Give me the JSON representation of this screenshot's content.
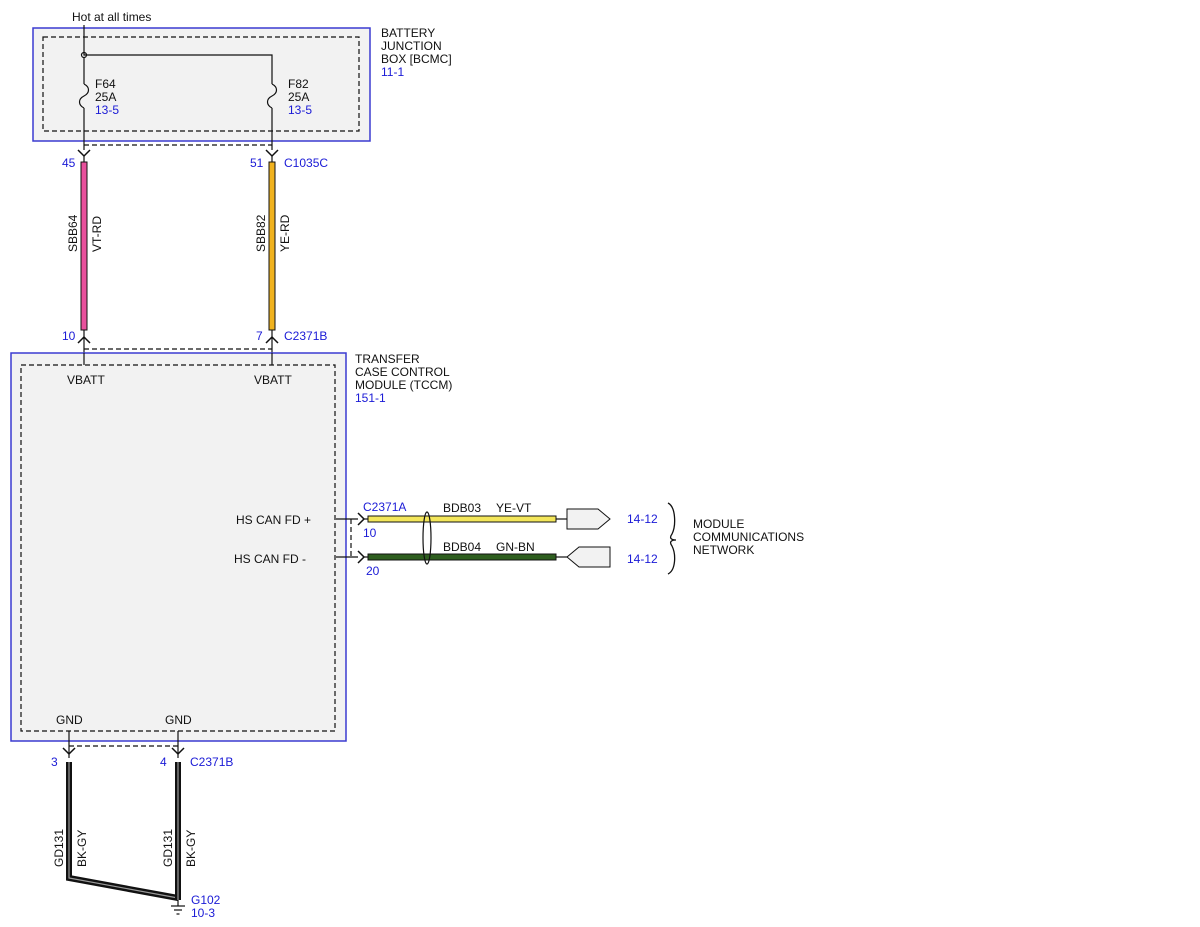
{
  "colors": {
    "module_border": "#3b3bd1",
    "module_fill": "#f2f2f2",
    "ref_text": "#1a1ad6",
    "wire_vt_rd": "#e8509c",
    "wire_ye_rd": "#f0b21e",
    "wire_ye_vt": "#f3e65a",
    "wire_gn_bn": "#2e5e1f",
    "wire_bk_gy": "#111111"
  },
  "supply_label": "Hot at all times",
  "bcmc": {
    "name_lines": [
      "BATTERY",
      "JUNCTION",
      "BOX [BCMC]"
    ],
    "ref": "11-1",
    "fuses": [
      {
        "id": "F64",
        "rating": "25A",
        "ref": "13-5"
      },
      {
        "id": "F82",
        "rating": "25A",
        "ref": "13-5"
      }
    ]
  },
  "c1035c": {
    "connector": "C1035C",
    "pins": [
      "45",
      "51"
    ]
  },
  "wires": {
    "sbb64": {
      "circuit": "SBB64",
      "color": "VT-RD"
    },
    "sbb82": {
      "circuit": "SBB82",
      "color": "YE-RD"
    },
    "bdb03": {
      "circuit": "BDB03",
      "color": "YE-VT"
    },
    "bdb04": {
      "circuit": "BDB04",
      "color": "GN-BN"
    },
    "gd131_a": {
      "circuit": "GD131",
      "color": "BK-GY"
    },
    "gd131_b": {
      "circuit": "GD131",
      "color": "BK-GY"
    }
  },
  "c2371b_top": {
    "connector": "C2371B",
    "pins": [
      "10",
      "7"
    ]
  },
  "tccm": {
    "name_lines": [
      "TRANSFER",
      "CASE CONTROL",
      "MODULE (TCCM)"
    ],
    "ref": "151-1",
    "pins": {
      "vbatt_1": "VBATT",
      "vbatt_2": "VBATT",
      "can_plus": "HS CAN FD +",
      "can_minus": "HS CAN FD -",
      "gnd_1": "GND",
      "gnd_2": "GND"
    }
  },
  "c2371a": {
    "connector": "C2371A",
    "pins": [
      "10",
      "20"
    ]
  },
  "network": {
    "refs": [
      "14-12",
      "14-12"
    ],
    "name_lines": [
      "MODULE",
      "COMMUNICATIONS",
      "NETWORK"
    ]
  },
  "c2371b_bottom": {
    "connector": "C2371B",
    "pins": [
      "3",
      "4"
    ]
  },
  "ground": {
    "id": "G102",
    "ref": "10-3"
  }
}
